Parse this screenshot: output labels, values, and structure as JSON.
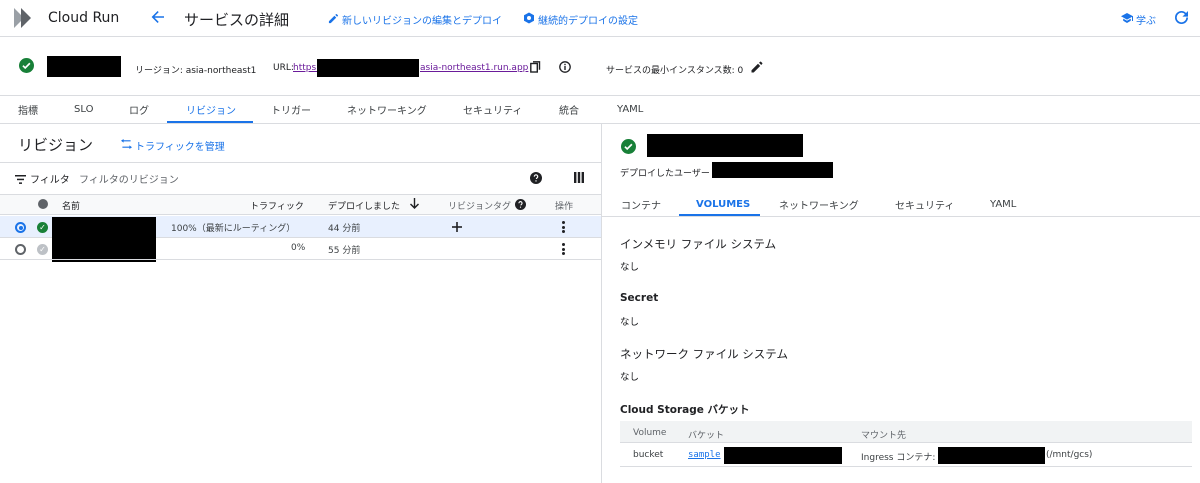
{
  "app": {
    "title": "Cloud Run",
    "page_title": "サービスの詳細",
    "actions": {
      "edit_deploy": "新しいリビジョンの編集とデプロイ",
      "continuous_deploy": "継続的デプロイの設定",
      "learn": "学ぶ"
    }
  },
  "service": {
    "region": "リージョン: asia-northeast1",
    "url_label": "URL:",
    "url_prefix": "https:",
    "url_suffix": "asia-northeast1.run.app",
    "min_instances": "サービスの最小インスタンス数: 0"
  },
  "tabs": [
    "指標",
    "SLO",
    "ログ",
    "リビジョン",
    "トリガー",
    "ネットワーキング",
    "セキュリティ",
    "統合",
    "YAML"
  ],
  "active_tab": "リビジョン",
  "revisions": {
    "title": "リビジョン",
    "manage_traffic": "トラフィックを管理",
    "filter_label": "フィルタ",
    "filter_placeholder": "フィルタのリビジョン",
    "columns": {
      "name": "名前",
      "traffic": "トラフィック",
      "deployed": "デプロイしました",
      "tag": "リビジョンタグ",
      "actions": "操作"
    },
    "rows": [
      {
        "traffic": "100%（最新にルーティング）",
        "deployed": "44 分前",
        "selected": true,
        "status": "active"
      },
      {
        "traffic": "0%",
        "deployed": "55 分前",
        "selected": false,
        "status": "inactive"
      }
    ]
  },
  "detail": {
    "deployed_by": "デプロイしたユーザー",
    "tabs": [
      "コンテナ",
      "VOLUMES",
      "ネットワーキング",
      "セキュリティ",
      "YAML"
    ],
    "active_tab": "VOLUMES",
    "sections": {
      "in_memory": {
        "title": "インメモリ ファイル システム",
        "value": "なし"
      },
      "secret": {
        "title": "Secret",
        "value": "なし"
      },
      "network_fs": {
        "title": "ネットワーク ファイル システム",
        "value": "なし"
      },
      "gcs": {
        "title": "Cloud Storage バケット"
      }
    },
    "volume_table": {
      "headers": {
        "volume": "Volume",
        "bucket": "バケット",
        "mount": "マウント先"
      },
      "row": {
        "volume": "bucket",
        "bucket": "sample",
        "mount_prefix": "Ingress コンテナ:",
        "mount_suffix": "(/mnt/gcs)"
      }
    }
  },
  "colors": {
    "accent": "#1a73e8",
    "success": "#188038",
    "row_selected": "#e8f0fe"
  }
}
